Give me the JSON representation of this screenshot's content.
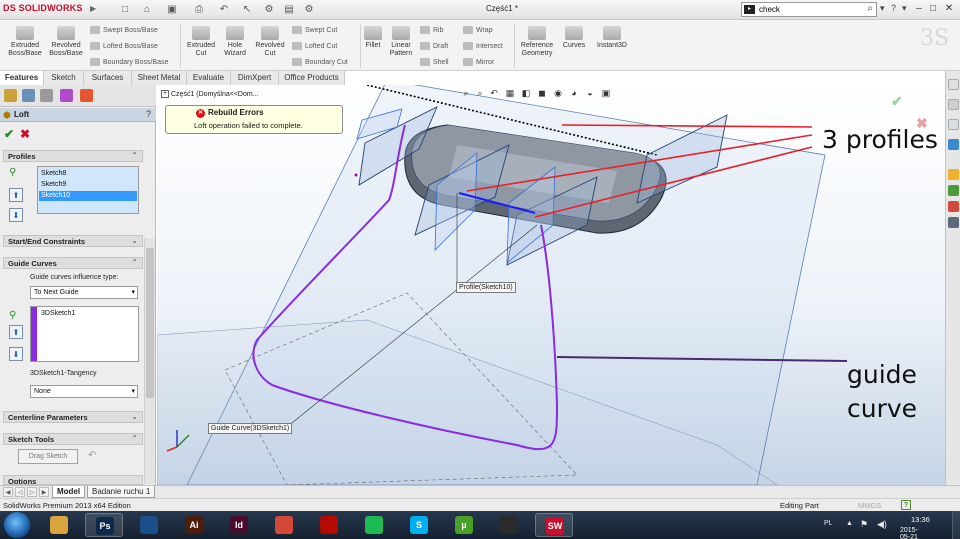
{
  "app": {
    "brand": "SOLIDWORKS",
    "document_title": "Część1 *",
    "search_placeholder": "check"
  },
  "command_manager": {
    "large": [
      {
        "label1": "Extruded",
        "label2": "Boss/Base"
      },
      {
        "label1": "Revolved",
        "label2": "Boss/Base"
      },
      {
        "label1": "Extruded",
        "label2": "Cut"
      },
      {
        "label1": "Hole",
        "label2": "Wizard"
      },
      {
        "label1": "Revolved",
        "label2": "Cut"
      },
      {
        "label1": "Fillet",
        "label2": ""
      },
      {
        "label1": "Linear",
        "label2": "Pattern"
      },
      {
        "label1": "Reference",
        "label2": "Geometry"
      },
      {
        "label1": "Curves",
        "label2": ""
      },
      {
        "label1": "Instant3D",
        "label2": ""
      }
    ],
    "small": [
      "Swept Boss/Base",
      "Lofted Boss/Base",
      "Boundary Boss/Base",
      "Swept Cut",
      "Lofted Cut",
      "Boundary Cut",
      "Rib",
      "Draft",
      "Shell",
      "Wrap",
      "Intersect",
      "Mirror"
    ]
  },
  "tabs": [
    "Features",
    "Sketch",
    "Surfaces",
    "Sheet Metal",
    "Evaluate",
    "DimXpert",
    "Office Products"
  ],
  "property_manager": {
    "title": "Loft",
    "help": "?",
    "profiles": {
      "title": "Profiles",
      "items": [
        "Sketch8",
        "Sketch9",
        "Sketch10"
      ],
      "selected_index": 2
    },
    "start_end": {
      "title": "Start/End Constraints"
    },
    "guide_curves": {
      "title": "Guide Curves",
      "influence_label": "Guide curves influence type:",
      "influence_value": "To Next Guide",
      "items": [
        "3DSketch1"
      ],
      "tangency_label": "3DSketch1-Tangency",
      "tangency_value": "None"
    },
    "centerline": {
      "title": "Centerline Parameters"
    },
    "sketch_tools": {
      "title": "Sketch Tools",
      "drag_button": "Drag Sketch"
    },
    "options": {
      "title": "Options"
    }
  },
  "viewport": {
    "tree_node": "Część1 (Domyślna<<Dom...",
    "rebuild_title": "Rebuild Errors",
    "rebuild_message": "Loft operation failed to complete.",
    "profile_callout": "Profile(Sketch10)",
    "guide_callout": "Guide Curve(3DSketch1)",
    "annotation_profiles": "3 profiles",
    "annotation_guide_1": "guide",
    "annotation_guide_2": "curve"
  },
  "model_tabs": [
    "Model",
    "Badanie ruchu 1"
  ],
  "status": {
    "left": "SolidWorks Premium 2013 x64 Edition",
    "mode": "Editing Part",
    "units": "MMGS",
    "help": "?"
  },
  "taskbar": {
    "language": "PL",
    "time": "13:36",
    "date": "2015-05-21",
    "apps": [
      {
        "name": "explorer",
        "glyph": "",
        "color": "#d8a53c"
      },
      {
        "name": "photoshop",
        "glyph": "Ps",
        "color": "#0c2a4a"
      },
      {
        "name": "cinema",
        "glyph": "",
        "color": "#1b4f8a"
      },
      {
        "name": "illustrator",
        "glyph": "Ai",
        "color": "#4a1e0a"
      },
      {
        "name": "indesign",
        "glyph": "Id",
        "color": "#4a0a2a"
      },
      {
        "name": "chrome",
        "glyph": "",
        "color": "#d34836"
      },
      {
        "name": "acrobat",
        "glyph": "",
        "color": "#b30b00"
      },
      {
        "name": "spotify",
        "glyph": "",
        "color": "#1db954"
      },
      {
        "name": "skype",
        "glyph": "S",
        "color": "#00aff0"
      },
      {
        "name": "utorrent",
        "glyph": "µ",
        "color": "#48a02a"
      },
      {
        "name": "steam",
        "glyph": "",
        "color": "#2a2a2a"
      },
      {
        "name": "solidworks",
        "glyph": "SW",
        "color": "#c8102e"
      }
    ]
  },
  "colors": {
    "accent": "#3399ff",
    "guide_curve": "#8a2be2",
    "annotation_line": "#e8202a",
    "error": "#d11111",
    "brand": "#c8102e"
  }
}
